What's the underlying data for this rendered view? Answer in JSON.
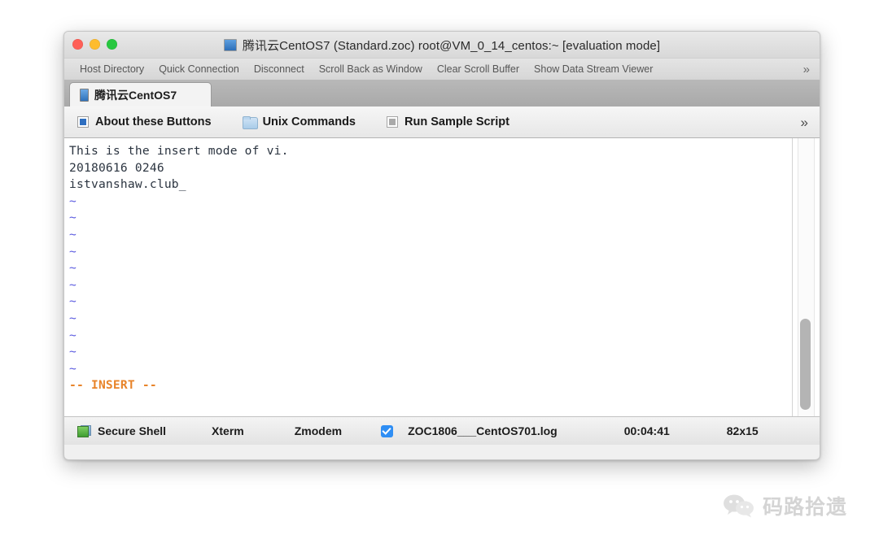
{
  "window": {
    "title": "腾讯云CentOS7 (Standard.zoc) root@VM_0_14_centos:~ [evaluation mode]",
    "title_icon": "app-window-icon",
    "traffic_lights": [
      {
        "name": "close",
        "color": "#ff5f57"
      },
      {
        "name": "minimize",
        "color": "#febc2e"
      },
      {
        "name": "maximize",
        "color": "#28c840"
      }
    ]
  },
  "menubar": {
    "items": [
      {
        "label": "Host Directory",
        "name": "menu-host-directory"
      },
      {
        "label": "Quick Connection",
        "name": "menu-quick-connection"
      },
      {
        "label": "Disconnect",
        "name": "menu-disconnect"
      },
      {
        "label": "Scroll Back as Window",
        "name": "menu-scroll-back-as-window"
      },
      {
        "label": "Clear Scroll Buffer",
        "name": "menu-clear-scroll-buffer"
      },
      {
        "label": "Show Data Stream Viewer",
        "name": "menu-show-data-stream-viewer"
      }
    ],
    "overflow_glyph": "»"
  },
  "tabs": [
    {
      "label": "腾讯云CentOS7",
      "active": true,
      "icon": "terminal-tab-icon"
    }
  ],
  "buttonbar": {
    "buttons": [
      {
        "label": "About these Buttons",
        "icon": "blue-square-icon"
      },
      {
        "label": "Unix Commands",
        "icon": "folder-icon"
      },
      {
        "label": "Run Sample Script",
        "icon": "gray-square-icon"
      }
    ],
    "overflow_glyph": "»"
  },
  "terminal": {
    "lines": [
      {
        "text": "This is the insert mode of vi.",
        "style": "normal"
      },
      {
        "text": "20180616 0246",
        "style": "normal"
      },
      {
        "text": "istvanshaw.club_",
        "style": "normal"
      },
      {
        "text": "~",
        "style": "tilde"
      },
      {
        "text": "~",
        "style": "tilde"
      },
      {
        "text": "~",
        "style": "tilde"
      },
      {
        "text": "~",
        "style": "tilde"
      },
      {
        "text": "~",
        "style": "tilde"
      },
      {
        "text": "~",
        "style": "tilde"
      },
      {
        "text": "~",
        "style": "tilde"
      },
      {
        "text": "~",
        "style": "tilde"
      },
      {
        "text": "~",
        "style": "tilde"
      },
      {
        "text": "~",
        "style": "tilde"
      },
      {
        "text": "~",
        "style": "tilde"
      },
      {
        "text": "-- INSERT --",
        "style": "insert"
      }
    ],
    "colors": {
      "text": "#2b3440",
      "tilde": "#5a5ae0",
      "insert": "#e8842a",
      "background": "#ffffff"
    },
    "scrollbar": {
      "thumb_color": "#b4b4b4",
      "position": "bottom"
    }
  },
  "statusbar": {
    "connection": "Secure Shell",
    "emulation": "Xterm",
    "transfer": "Zmodem",
    "logfile": "ZOC1806___CentOS701.log",
    "logging_enabled": true,
    "elapsed": "00:04:41",
    "size": "82x15"
  },
  "watermark": {
    "text": "码路拾遗",
    "logo": "wechat-logo"
  }
}
